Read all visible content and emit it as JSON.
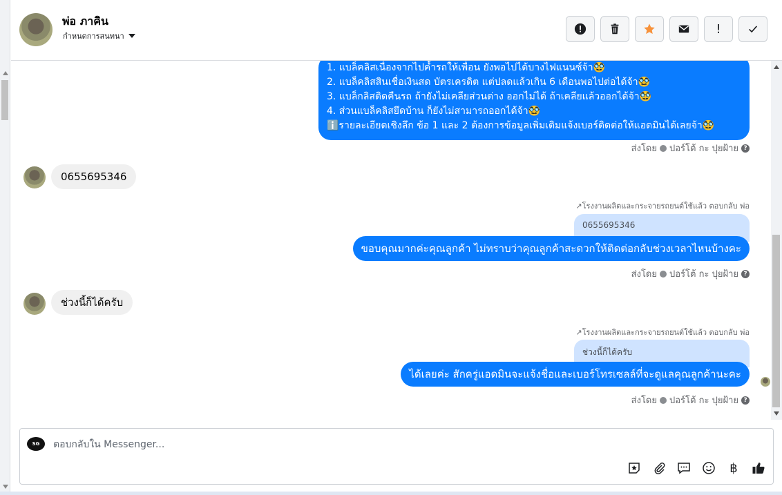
{
  "header": {
    "contact_name": "พ่อ ภาคิน",
    "assign_label": "กำหนดการสนทนา",
    "actions": [
      {
        "name": "spam-button",
        "icon": "alert-circle-icon"
      },
      {
        "name": "delete-button",
        "icon": "trash-icon"
      },
      {
        "name": "star-button",
        "icon": "star-icon"
      },
      {
        "name": "mark-unread-button",
        "icon": "envelope-icon"
      },
      {
        "name": "important-button",
        "icon": "exclamation-icon",
        "glyph": "!"
      },
      {
        "name": "done-button",
        "icon": "check-icon"
      }
    ]
  },
  "messages": {
    "list_message": {
      "lines": [
        "1. แบล็คลิสเนื่องจากไปค้ำรถให้เพื่อน ยังพอไปได้บางไฟแนนซ์จ้า🥸",
        "2. แบล็คลิสสินเชื่อเงินสด บัตรเครดิต แต่ปลดแล้วเกิน 6 เดือนพอไปต่อได้จ้า🥸",
        "3. แบล็กลิสติดคืนรถ ถ้ายังไม่เคลียส่วนต่าง ออกไม่ได้ ถ้าเคลียแล้วออกได้จ้า🥸",
        "4. ส่วนแบล็คลิสยึดบ้าน ก็ยังไม่สามารถออกได้จ้า🥸",
        "ℹ️รายละเอียดเชิงลึก ข้อ 1 และ 2 ต้องการข้อมูลเพิ่มเติมแจ้งเบอร์ติดต่อให้แอดมินได้เลยจ้า🥸"
      ]
    },
    "sent_by_label": "ส่งโดย",
    "sent_by_name": "ปอร์โต้ กะ ปุยฝ้าย",
    "incoming_1": "0655695346",
    "reply_1": {
      "label": "โรงงานผลิตและกระจายรถยนต์ใช้แล้ว ตอบกลับ พ่อ",
      "quoted": "0655695346",
      "text": "ขอบคุณมากค่ะคุณลูกค้า ไม่ทราบว่าคุณลูกค้าสะดวกให้ติดต่อกลับช่วงเวลาไหนบ้างคะ"
    },
    "incoming_2": "ช่วงนี้ก็ได้ครับ",
    "reply_2": {
      "label": "โรงงานผลิตและกระจายรถยนต์ใช้แล้ว ตอบกลับ พ่อ",
      "quoted": "ช่วงนี้ก็ได้ครับ",
      "text": "ได้เลยค่ะ สักครู่แอดมินจะแจ้งชื่อและเบอร์โทรเซลล์ที่จะดูแลคุณลูกค้านะคะ"
    }
  },
  "composer": {
    "placeholder": "ตอบกลับใน Messenger...",
    "value": "",
    "page_avatar_text": "SG",
    "tools": [
      "sticker-icon",
      "attachment-icon",
      "saved-reply-icon",
      "emoji-icon",
      "baht-icon",
      "like-icon"
    ],
    "baht_glyph": "฿"
  },
  "colors": {
    "outgoing_bubble": "#0a7cff",
    "incoming_bubble": "#f0f0f0",
    "quoted_bubble": "#cfe3ff",
    "star_active": "#f7923b"
  }
}
